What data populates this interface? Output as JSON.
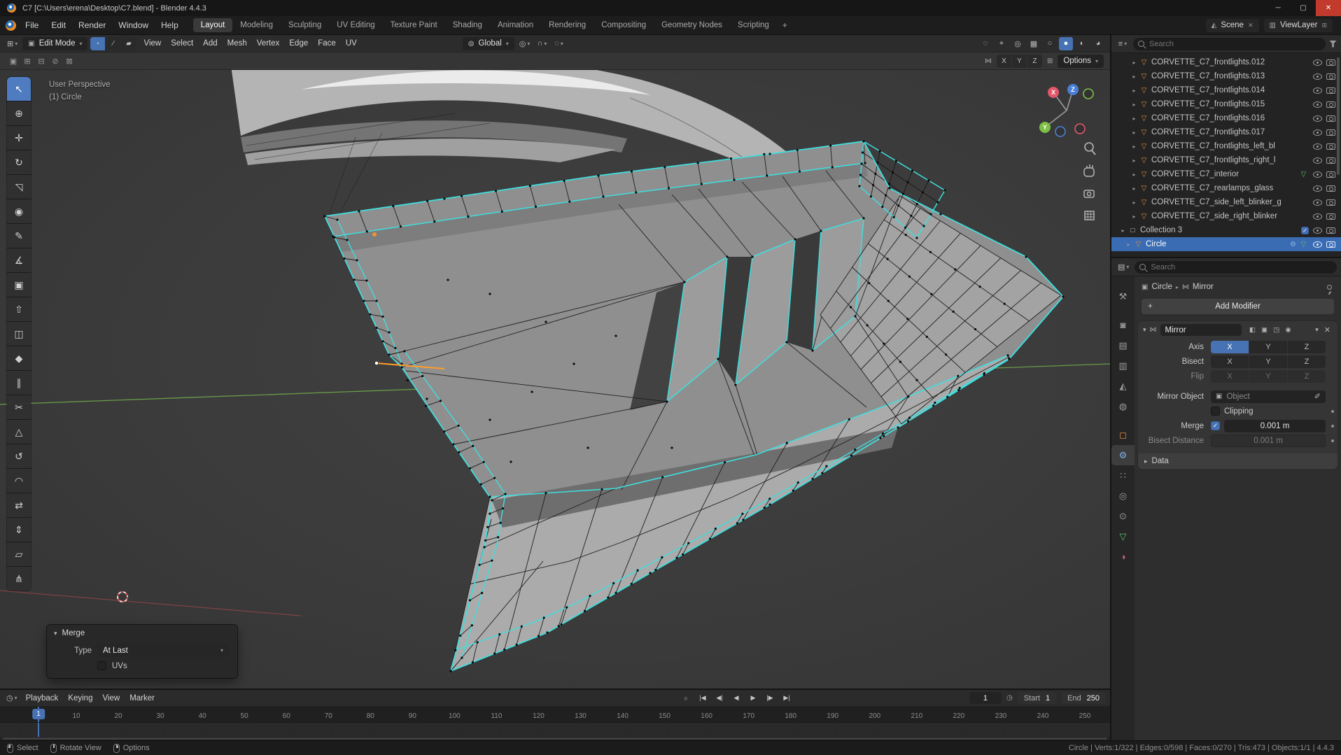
{
  "window": {
    "title": "C7 [C:\\Users\\erena\\Desktop\\C7.blend] - Blender 4.4.3",
    "controls": {
      "minimize": "─",
      "maximize": "▢",
      "close": "✕"
    }
  },
  "icons": {
    "caret_down": "▾",
    "caret_right": "▸",
    "plus": "+",
    "checkmark": "✓",
    "close": "✕",
    "scene": "◭",
    "viewlayer": "▥",
    "copy": "⊞",
    "editor_grid": "⊞",
    "cube": "▣",
    "globe": "◍",
    "pivot": "◎",
    "magnet": "∩",
    "proportional": "◌",
    "mirror": "⋈",
    "grid": "⊞",
    "object": "▣",
    "eyedropper": "✐",
    "clock": "◷",
    "outliner": "≡",
    "properties": "▤",
    "mesh": "▽",
    "collection": "□",
    "wrench": "⚙"
  },
  "topbar": {
    "menus": [
      "File",
      "Edit",
      "Render",
      "Window",
      "Help"
    ],
    "workspaces": [
      "Layout",
      "Modeling",
      "Sculpting",
      "UV Editing",
      "Texture Paint",
      "Shading",
      "Animation",
      "Rendering",
      "Compositing",
      "Geometry Nodes",
      "Scripting"
    ],
    "active_workspace": "Layout",
    "add_tab": "+",
    "scene_name": "Scene",
    "viewlayer_name": "ViewLayer"
  },
  "viewport": {
    "header": {
      "mode": "Edit Mode",
      "orientation": "Global",
      "menus": [
        "View",
        "Select",
        "Add",
        "Mesh",
        "Vertex",
        "Edge",
        "Face",
        "UV"
      ],
      "select_modes": [
        {
          "name": "vertex",
          "icon": "◦",
          "active": true
        },
        {
          "name": "edge",
          "icon": "∕"
        },
        {
          "name": "face",
          "icon": "▰"
        }
      ],
      "right_icons": [
        {
          "name": "show-object-types",
          "icon": "◌"
        },
        {
          "name": "show-gizmo",
          "icon": "⌖"
        },
        {
          "name": "show-overlays",
          "icon": "◎"
        },
        {
          "name": "toggle-xray",
          "icon": "▦"
        },
        {
          "name": "shading-wireframe",
          "icon": "○"
        },
        {
          "name": "shading-solid",
          "icon": "●",
          "active": true
        },
        {
          "name": "shading-material",
          "icon": "◐"
        },
        {
          "name": "shading-rendered",
          "icon": "◕"
        }
      ]
    },
    "tool_settings": {
      "select_modes": [
        {
          "name": "select-set",
          "icon": "▣"
        },
        {
          "name": "select-extend",
          "icon": "⊞"
        },
        {
          "name": "select-subtract",
          "icon": "⊟"
        },
        {
          "name": "select-invert",
          "icon": "⊘"
        },
        {
          "name": "select-intersect",
          "icon": "⊠"
        }
      ],
      "mirror_axes": [
        "X",
        "Y",
        "Z"
      ],
      "options_label": "Options"
    },
    "overlay": {
      "perspective": "User Perspective",
      "active_object": "(1) Circle"
    },
    "gizmo_axes": {
      "x": "X",
      "y": "Y",
      "z": "Z"
    },
    "tools": [
      {
        "name": "Tweak",
        "icon": "↖"
      },
      {
        "name": "Cursor",
        "icon": "⊕"
      },
      {
        "name": "Move",
        "icon": "✛"
      },
      {
        "name": "Rotate",
        "icon": "↻"
      },
      {
        "name": "Scale",
        "icon": "◹"
      },
      {
        "name": "Transform",
        "icon": "◉"
      },
      {
        "name": "Annotate",
        "icon": "✎"
      },
      {
        "name": "Measure",
        "icon": "∡"
      },
      {
        "name": "Add Cube",
        "icon": "▣"
      },
      {
        "name": "Extrude Region",
        "icon": "⇧"
      },
      {
        "name": "Inset Faces",
        "icon": "◫"
      },
      {
        "name": "Bevel",
        "icon": "◆"
      },
      {
        "name": "Loop Cut",
        "icon": "∥"
      },
      {
        "name": "Knife",
        "icon": "✂"
      },
      {
        "name": "Poly Build",
        "icon": "△"
      },
      {
        "name": "Spin",
        "icon": "↺"
      },
      {
        "name": "Smooth",
        "icon": "◠"
      },
      {
        "name": "Edge Slide",
        "icon": "⇄"
      },
      {
        "name": "Shrink/Fatten",
        "icon": "⇕"
      },
      {
        "name": "Shear",
        "icon": "▱"
      },
      {
        "name": "Rip Region",
        "icon": "⋔"
      }
    ]
  },
  "operator_panel": {
    "title": "Merge",
    "type_label": "Type",
    "type_value": "At Last",
    "uvs_label": "UVs"
  },
  "outliner": {
    "search_placeholder": "Search",
    "items": [
      {
        "label": "CORVETTE_C7_frontlights.012",
        "indent": 22
      },
      {
        "label": "CORVETTE_C7_frontlights.013",
        "indent": 22
      },
      {
        "label": "CORVETTE_C7_frontlights.014",
        "indent": 22
      },
      {
        "label": "CORVETTE_C7_frontlights.015",
        "indent": 22
      },
      {
        "label": "CORVETTE_C7_frontlights.016",
        "indent": 22
      },
      {
        "label": "CORVETTE_C7_frontlights.017",
        "indent": 22
      },
      {
        "label": "CORVETTE_C7_frontlights_left_bl",
        "indent": 22
      },
      {
        "label": "CORVETTE_C7_frontlights_right_l",
        "indent": 22
      },
      {
        "label": "CORVETTE_C7_interior",
        "indent": 22,
        "badges": [
          "data"
        ]
      },
      {
        "label": "CORVETTE_C7_rearlamps_glass",
        "indent": 22
      },
      {
        "label": "CORVETTE_C7_side_left_blinker_g",
        "indent": 22
      },
      {
        "label": "CORVETTE_C7_side_right_blinker",
        "indent": 22
      },
      {
        "label": "Collection 3",
        "indent": 6,
        "type": "collection",
        "checkbox": true
      },
      {
        "label": "Circle",
        "indent": 14,
        "selected": true,
        "badges": [
          "modifier",
          "data"
        ]
      }
    ]
  },
  "properties": {
    "search_placeholder": "Search",
    "active_tab": "Modifiers",
    "tabs": [
      {
        "name": "Tool",
        "icon": "⚒"
      },
      {
        "name": "Render",
        "icon": "◙",
        "gap": true
      },
      {
        "name": "Output",
        "icon": "▤"
      },
      {
        "name": "View Layer",
        "icon": "▥"
      },
      {
        "name": "Scene",
        "icon": "◭"
      },
      {
        "name": "World",
        "icon": "◍"
      },
      {
        "name": "Object",
        "icon": "◻",
        "color": "#e0883c",
        "gap": true
      },
      {
        "name": "Modifiers",
        "icon": "⚙",
        "color": "#7fb0e8"
      },
      {
        "name": "Particles",
        "icon": "∷"
      },
      {
        "name": "Physics",
        "icon": "◎"
      },
      {
        "name": "Constraints",
        "icon": "⊙"
      },
      {
        "name": "Object Data",
        "icon": "▽",
        "color": "#55c464"
      },
      {
        "name": "Material",
        "icon": "◑",
        "color": "#cf6679"
      }
    ],
    "breadcrumb": {
      "object": "Circle",
      "modifier": "Mirror"
    },
    "add_modifier_label": "Add Modifier",
    "modifier": {
      "name": "Mirror",
      "header_icons": [
        {
          "name": "display-on-cage",
          "icon": "◧"
        },
        {
          "name": "display-edit-mode",
          "icon": "▣"
        },
        {
          "name": "display-realtime",
          "icon": "◳"
        },
        {
          "name": "display-render",
          "icon": "◉"
        }
      ],
      "axis_label": "Axis",
      "bisect_label": "Bisect",
      "flip_label": "Flip",
      "axis_buttons": [
        "X",
        "Y",
        "Z"
      ],
      "active_axis": "X",
      "mirror_object_label": "Mirror Object",
      "mirror_object_placeholder": "Object",
      "clipping_label": "Clipping",
      "merge_label": "Merge",
      "merge_value": "0.001 m",
      "bisect_distance_label": "Bisect Distance",
      "bisect_distance_value": "0.001 m",
      "data_label": "Data"
    }
  },
  "timeline": {
    "menus": [
      "Playback",
      "Keying",
      "View",
      "Marker"
    ],
    "transport": [
      {
        "name": "auto-keying",
        "icon": "○"
      },
      {
        "name": "jump-to-start",
        "icon": "|◀"
      },
      {
        "name": "jump-to-prev-keyframe",
        "icon": "◀|"
      },
      {
        "name": "play-reverse",
        "icon": "◀"
      },
      {
        "name": "play",
        "icon": "▶"
      },
      {
        "name": "jump-to-next-keyframe",
        "icon": "|▶"
      },
      {
        "name": "jump-to-end",
        "icon": "▶|"
      }
    ],
    "current_frame": "1",
    "start_label": "Start",
    "start_value": "1",
    "end_label": "End",
    "end_value": "250",
    "ticks": [
      1,
      10,
      20,
      30,
      40,
      50,
      60,
      70,
      80,
      90,
      100,
      110,
      120,
      130,
      140,
      150,
      160,
      170,
      180,
      190,
      200,
      210,
      220,
      230,
      240,
      250
    ]
  },
  "statusbar": {
    "hints": [
      "Select",
      "Rotate View",
      "Options"
    ],
    "stats": "Circle | Verts:1/322 | Edges:0/598 | Faces:0/270 | Tris:473 | Objects:1/1 | 4.4.3"
  }
}
